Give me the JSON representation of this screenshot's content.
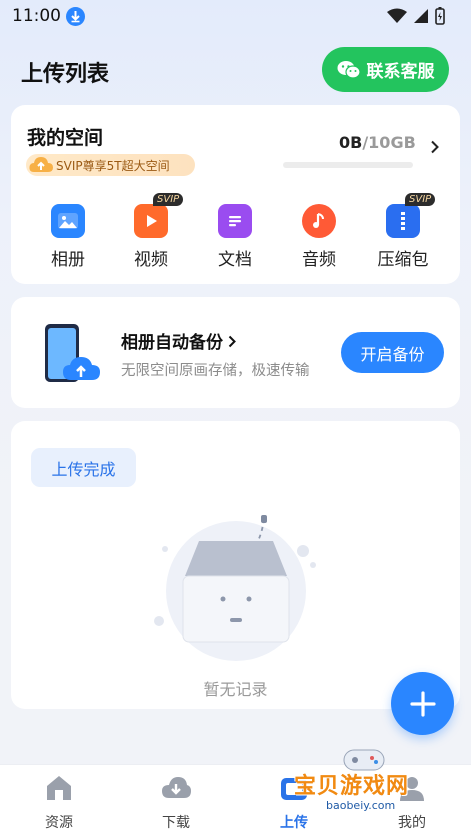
{
  "status_bar": {
    "time": "11:00"
  },
  "header": {
    "title": "上传列表",
    "support_label": "联系客服"
  },
  "space": {
    "title": "我的空间",
    "svip_promo": "SVIP尊享5T超大空间",
    "used": "0B",
    "separator": "/",
    "total": "10GB",
    "usage_fraction": 0
  },
  "categories": [
    {
      "label": "相册",
      "icon": "photo-icon",
      "color": "#2a86ff",
      "badge": ""
    },
    {
      "label": "视频",
      "icon": "video-icon",
      "color": "#ff6a2b",
      "badge": "SVIP"
    },
    {
      "label": "文档",
      "icon": "document-icon",
      "color": "#9a4cf0",
      "badge": ""
    },
    {
      "label": "音频",
      "icon": "music-icon",
      "color": "#ff5a36",
      "badge": ""
    },
    {
      "label": "压缩包",
      "icon": "zip-icon",
      "color": "#2a6ef0",
      "badge": "SVIP"
    }
  ],
  "backup": {
    "title": "相册自动备份",
    "subtitle": "无限空间原画存储，极速传输",
    "button_label": "开启备份"
  },
  "upload_list": {
    "tab_label": "上传完成",
    "empty_text": "暂无记录"
  },
  "bottom_nav": [
    {
      "label": "资源",
      "active": false
    },
    {
      "label": "下载",
      "active": false
    },
    {
      "label": "上传",
      "active": true
    },
    {
      "label": "我的",
      "active": false
    }
  ],
  "watermark": {
    "text": "宝贝游戏网",
    "url": "baobeiy.com"
  },
  "colors": {
    "accent": "#2a86ff",
    "support_green": "#23c45e"
  }
}
